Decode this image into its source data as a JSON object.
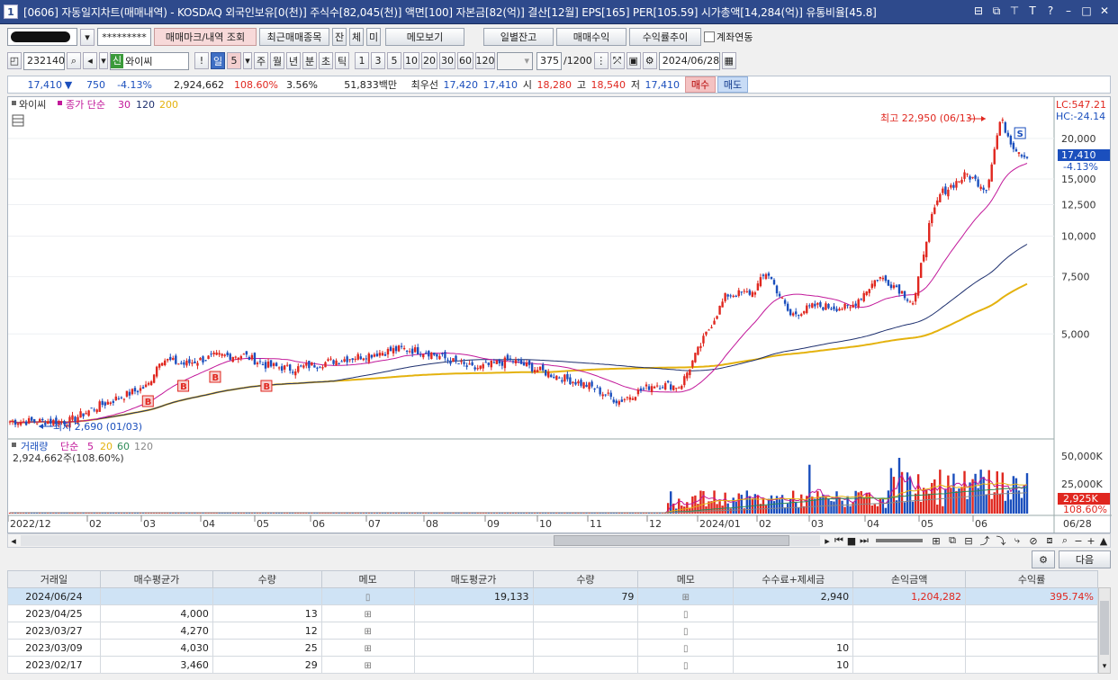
{
  "window": {
    "number": "1",
    "title": "[0606] 자동일지차트(매매내역) - KOSDAQ 외국인보유[0(천)] 주식수[82,045(천)] 액면[100] 자본금[82(억)] 결산[12월] EPS[165] PER[105.59] 시가총액[14,284(억)] 유통비율[45.8]"
  },
  "toolbar1": {
    "account_mask": "*********",
    "mark_btn": "매매마크/내역 조회",
    "recent_btn": "최근매매종목",
    "jan_btn": "잔",
    "che_btn": "체",
    "mi_btn": "미",
    "memo_btn": "메모보기",
    "daily_btn": "일별잔고",
    "profit_btn": "매매수익",
    "trend_btn": "수익률추이",
    "link_label": "계좌연동"
  },
  "toolbar2": {
    "code": "232140",
    "credit_badge": "신",
    "stock_name": "와이씨",
    "period_selected": "일",
    "period_value": "5",
    "periods": [
      "주",
      "월",
      "년",
      "분",
      "초",
      "틱"
    ],
    "intervals": [
      "1",
      "3",
      "5",
      "10",
      "20",
      "30",
      "60",
      "120"
    ],
    "count": "375",
    "count_total": "/1200",
    "date": "2024/06/28"
  },
  "quote": {
    "price": "17,410",
    "arrow": "▼",
    "change": "750",
    "change_pct": "-4.13%",
    "volume": "2,924,662",
    "vol_ratio": "108.60%",
    "turnover": "3.56%",
    "amount": "51,833백만",
    "best_label": "최우선",
    "best_ask": "17,420",
    "best_bid": "17,410",
    "open_label": "시",
    "open": "18,280",
    "high_label": "고",
    "high": "18,540",
    "low_label": "저",
    "low": "17,410",
    "buy_btn": "매수",
    "sell_btn": "매도"
  },
  "chart_data": {
    "type": "line",
    "legend": {
      "name": "와이씨",
      "ma_label": "종가 단순",
      "ma": [
        "30",
        "120",
        "200"
      ]
    },
    "colors": {
      "up": "#e0271f",
      "down": "#1b4fbd",
      "ma30": "#c2189a",
      "ma120": "#1d2f6e",
      "ma200": "#e4b20e"
    },
    "y_ticks": [
      "20,000",
      "15,000",
      "12,500",
      "10,000",
      "7,500",
      "5,000"
    ],
    "y_scale": "log",
    "x_ticks": [
      "2022/12",
      "02",
      "03",
      "04",
      "05",
      "06",
      "07",
      "08",
      "09",
      "10",
      "11",
      "12",
      "2024/01",
      "02",
      "03",
      "04",
      "05",
      "06",
      "06/28"
    ],
    "annot_high": "최고 22,950 (06/13)",
    "annot_low": "최저 2,690 (01/03)",
    "trade_marks": [
      "B",
      "B",
      "B",
      "B",
      "S"
    ],
    "lc_label": "LC:547.21",
    "hc_label": "HC:-24.14",
    "last_price": "17,410",
    "last_pct": "-4.13%",
    "close_series": [
      {
        "x": "2023/01/03",
        "y": 2690
      },
      {
        "x": "2023/01/20",
        "y": 3000
      },
      {
        "x": "2023/02/17",
        "y": 3460
      },
      {
        "x": "2023/02/24",
        "y": 4200
      },
      {
        "x": "2023/03/09",
        "y": 4030
      },
      {
        "x": "2023/03/27",
        "y": 4270
      },
      {
        "x": "2023/04/12",
        "y": 4300
      },
      {
        "x": "2023/04/25",
        "y": 4000
      },
      {
        "x": "2023/05/10",
        "y": 3900
      },
      {
        "x": "2023/05/30",
        "y": 4100
      },
      {
        "x": "2023/06/20",
        "y": 4300
      },
      {
        "x": "2023/07/10",
        "y": 4500
      },
      {
        "x": "2023/07/25",
        "y": 4400
      },
      {
        "x": "2023/08/20",
        "y": 3900
      },
      {
        "x": "2023/09/10",
        "y": 4150
      },
      {
        "x": "2023/09/30",
        "y": 3800
      },
      {
        "x": "2023/10/25",
        "y": 3450
      },
      {
        "x": "2023/11/10",
        "y": 3100
      },
      {
        "x": "2023/11/30",
        "y": 3500
      },
      {
        "x": "2023/12/15",
        "y": 3450
      },
      {
        "x": "2023/12/28",
        "y": 4800
      },
      {
        "x": "2024/01/10",
        "y": 6600
      },
      {
        "x": "2024/01/25",
        "y": 6700
      },
      {
        "x": "2024/02/02",
        "y": 7800
      },
      {
        "x": "2024/02/15",
        "y": 5700
      },
      {
        "x": "2024/02/29",
        "y": 6100
      },
      {
        "x": "2024/03/20",
        "y": 6000
      },
      {
        "x": "2024/04/05",
        "y": 7500
      },
      {
        "x": "2024/04/15",
        "y": 7000
      },
      {
        "x": "2024/04/25",
        "y": 6200
      },
      {
        "x": "2024/05/03",
        "y": 10500
      },
      {
        "x": "2024/05/10",
        "y": 13500
      },
      {
        "x": "2024/05/25",
        "y": 15500
      },
      {
        "x": "2024/06/05",
        "y": 14000
      },
      {
        "x": "2024/06/13",
        "y": 22950
      },
      {
        "x": "2024/06/20",
        "y": 19000
      },
      {
        "x": "2024/06/28",
        "y": 17410
      }
    ],
    "volume": {
      "label": "거래량",
      "ma_label": "단순",
      "ma": [
        "5",
        "20",
        "60",
        "120"
      ],
      "value": "2,924,662주(108.60%)",
      "y_ticks": [
        "50,000K",
        "25,000K"
      ],
      "last": "2,925K",
      "last_pct": "108.60%"
    },
    "total_label": "06/28"
  },
  "trades_table": {
    "headers": [
      "거래일",
      "매수평균가",
      "수량",
      "메모",
      "매도평균가",
      "수량",
      "메모",
      "수수료+제세금",
      "손익금액",
      "수익률"
    ],
    "rows": [
      [
        "2024/06/24",
        "",
        "",
        "",
        "19,133",
        "79",
        "",
        "2,940",
        "1,204,282",
        "395.74%"
      ],
      [
        "2023/04/25",
        "4,000",
        "13",
        "",
        "",
        "",
        "",
        "",
        "",
        ""
      ],
      [
        "2023/03/27",
        "4,270",
        "12",
        "",
        "",
        "",
        "",
        "",
        "",
        ""
      ],
      [
        "2023/03/09",
        "4,030",
        "25",
        "",
        "",
        "",
        "",
        "10",
        "",
        ""
      ],
      [
        "2023/02/17",
        "3,460",
        "29",
        "",
        "",
        "",
        "",
        "10",
        "",
        ""
      ]
    ],
    "next_btn": "다음"
  }
}
